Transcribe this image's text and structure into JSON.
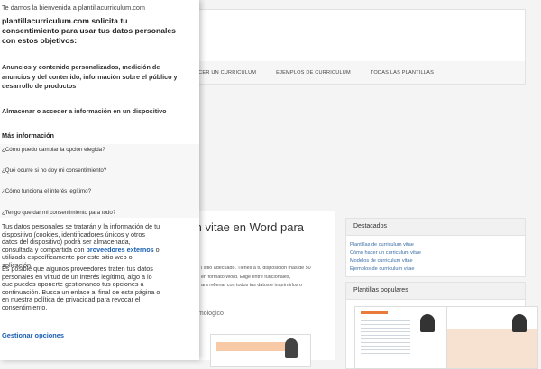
{
  "site": {
    "nav": [
      "HACER UN CURRICULUM",
      "EJEMPLOS DE CURRICULUM",
      "TODAS LAS PLANTILLAS"
    ],
    "article_title": "m vitae en Word para",
    "article_lines": [
      "l sitio adecuado. Tienes a tu disposición más de 50",
      "en formato Word. Elige entre funcionales,",
      "ara rellenar con todos tus datos e imprimirlos o"
    ],
    "homologado": "omologico",
    "sidebar": {
      "destacados_title": "Destacados",
      "destacados_links": [
        "Plantillas de curriculum vitae",
        "Cómo hacer un curriculum vitae",
        "Modelos de curriculum vitae",
        "Ejemplos de curriculum vitae"
      ],
      "populares_title": "Plantillas populares"
    }
  },
  "consent": {
    "welcome": "Te damos la bienvenida a plantillacurriculum.com",
    "title": "plantillacurriculum.com solicita tu consentimiento para usar tus datos personales con estos objetivos:",
    "purposes": [
      "Anuncios y contenido personalizados, medición de anuncios y del contenido, información sobre el público y desarrollo de productos",
      "Almacenar o acceder a información en un dispositivo"
    ],
    "more_info": "Más información",
    "faq": [
      "¿Cómo puedo cambiar la opción elegida?",
      "¿Qué ocurre si no doy mi consentimiento?",
      "¿Cómo funciona el interés legítimo?",
      "¿Tengo que dar mi consentimiento para todo?"
    ],
    "para1_before": "Tus datos personales se tratarán y la información de tu dispositivo (cookies, identificadores únicos y otros datos del dispositivo) podrá ser almacenada, consultada y compartida con ",
    "para1_link": "proveedores externos",
    "para1_after": " o utilizada específicamente por este sitio web o aplicación.",
    "para2": "Es posible que algunos proveedores traten tus datos personales en virtud de un interés legítimo, algo a lo que puedes oponerte gestionando tus opciones a continuación. Busca un enlace al final de esta página o en nuestra política de privacidad para revocar el consentimiento.",
    "manage": "Gestionar opciones"
  }
}
